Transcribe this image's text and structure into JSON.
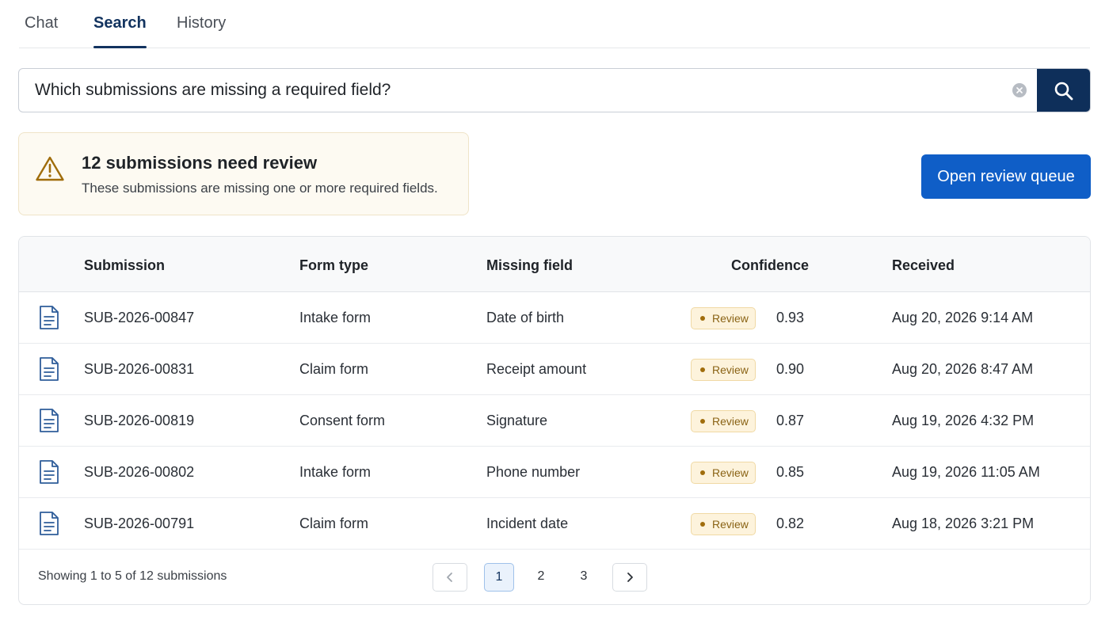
{
  "tabs": [
    {
      "label": "Chat",
      "active": false
    },
    {
      "label": "Search",
      "active": true
    },
    {
      "label": "History",
      "active": false
    }
  ],
  "search": {
    "value": "Which submissions are missing a required field?",
    "clear_icon": "clear-icon",
    "button_icon": "search-icon"
  },
  "alert": {
    "icon": "warning-icon",
    "title": "12 submissions need review",
    "text": "These submissions are missing one or more required fields."
  },
  "actions": {
    "open_queue_label": "Open review queue"
  },
  "table": {
    "headers": {
      "submission": "Submission",
      "form_type": "Form type",
      "missing_field": "Missing field",
      "confidence": "Confidence",
      "received": "Received"
    },
    "rows": [
      {
        "icon": "document-icon",
        "submission": "SUB-2026-00847",
        "form_type": "Intake form",
        "missing_field": "Date of birth",
        "badge": "Review",
        "confidence": "0.93",
        "received": "Aug 20, 2026 9:14 AM"
      },
      {
        "icon": "document-icon",
        "submission": "SUB-2026-00831",
        "form_type": "Claim form",
        "missing_field": "Receipt amount",
        "badge": "Review",
        "confidence": "0.90",
        "received": "Aug 20, 2026 8:47 AM"
      },
      {
        "icon": "document-icon",
        "submission": "SUB-2026-00819",
        "form_type": "Consent form",
        "missing_field": "Signature",
        "badge": "Review",
        "confidence": "0.87",
        "received": "Aug 19, 2026 4:32 PM"
      },
      {
        "icon": "document-icon",
        "submission": "SUB-2026-00802",
        "form_type": "Intake form",
        "missing_field": "Phone number",
        "badge": "Review",
        "confidence": "0.85",
        "received": "Aug 19, 2026 11:05 AM"
      },
      {
        "icon": "document-icon",
        "submission": "SUB-2026-00791",
        "form_type": "Claim form",
        "missing_field": "Incident date",
        "badge": "Review",
        "confidence": "0.82",
        "received": "Aug 18, 2026 3:21 PM"
      }
    ]
  },
  "pagination": {
    "summary": "Showing 1 to 5 of 12 submissions",
    "prev_icon": "chevron-left-icon",
    "next_icon": "chevron-right-icon",
    "pages": [
      "1",
      "2",
      "3"
    ],
    "current_page": "1"
  },
  "colors": {
    "primary": "#0f5ec7",
    "navy": "#0e2f5a",
    "warning": "#a06d0c",
    "badge_bg": "#fdf3dc"
  }
}
